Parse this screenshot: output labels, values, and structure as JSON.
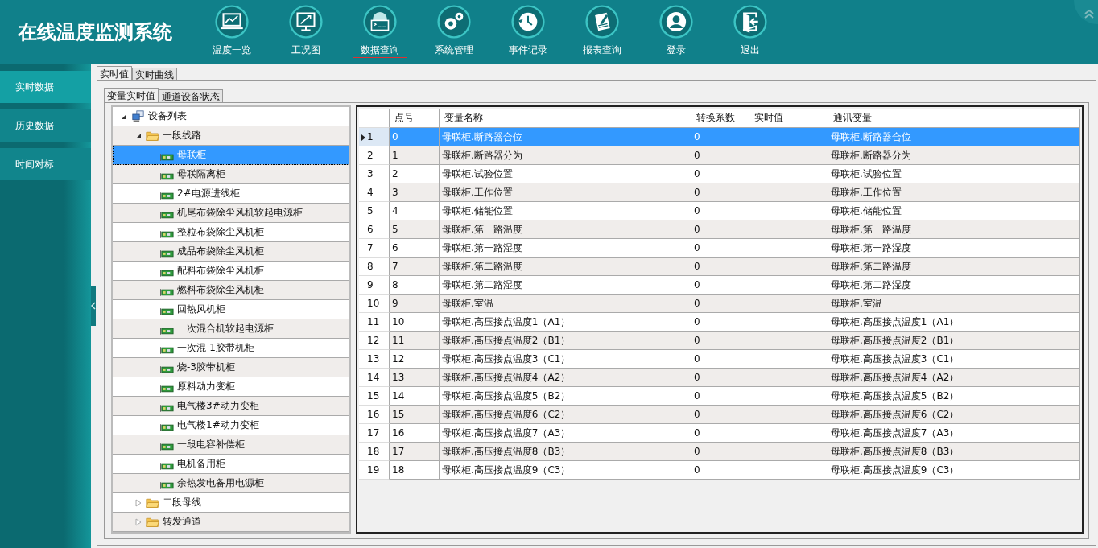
{
  "header": {
    "title": "在线温度监测系统"
  },
  "nav": [
    {
      "label": "温度一览",
      "kind": "monitor-chart",
      "selected": false
    },
    {
      "label": "工况图",
      "kind": "monitor-tools",
      "selected": false
    },
    {
      "label": "数据查询",
      "kind": "gear-terminal",
      "selected": true
    },
    {
      "label": "系统管理",
      "kind": "gears",
      "selected": false
    },
    {
      "label": "事件记录",
      "kind": "clock",
      "selected": false
    },
    {
      "label": "报表查询",
      "kind": "document",
      "selected": false
    },
    {
      "label": "登录",
      "kind": "user",
      "selected": false
    },
    {
      "label": "退出",
      "kind": "exit",
      "selected": false
    }
  ],
  "sidebar": {
    "items": [
      {
        "label": "实时数据",
        "selected": true
      },
      {
        "label": "历史数据",
        "selected": false
      },
      {
        "label": "时间对标",
        "selected": false
      }
    ]
  },
  "tabs": [
    {
      "label": "实时值",
      "selected": true
    },
    {
      "label": "实时曲线",
      "selected": false
    }
  ],
  "sub_tabs": [
    {
      "label": "变量实时值",
      "selected": true
    },
    {
      "label": "通道设备状态",
      "selected": false
    }
  ],
  "tree": [
    {
      "label": "设备列表",
      "kind": "root",
      "expanded": true,
      "selected": false,
      "children": [
        {
          "label": "一段线路",
          "kind": "folder",
          "expanded": true,
          "selected": false,
          "children": [
            {
              "label": "母联柜",
              "kind": "device",
              "selected": true
            },
            {
              "label": "母联隔离柜",
              "kind": "device",
              "selected": false
            },
            {
              "label": "2#电源进线柜",
              "kind": "device",
              "selected": false
            },
            {
              "label": "机尾布袋除尘风机软起电源柜",
              "kind": "device",
              "selected": false
            },
            {
              "label": "整粒布袋除尘风机柜",
              "kind": "device",
              "selected": false
            },
            {
              "label": "成品布袋除尘风机柜",
              "kind": "device",
              "selected": false
            },
            {
              "label": "配料布袋除尘风机柜",
              "kind": "device",
              "selected": false
            },
            {
              "label": "燃料布袋除尘风机柜",
              "kind": "device",
              "selected": false
            },
            {
              "label": "回热风机柜",
              "kind": "device",
              "selected": false
            },
            {
              "label": "一次混合机软起电源柜",
              "kind": "device",
              "selected": false
            },
            {
              "label": "一次混-1胶带机柜",
              "kind": "device",
              "selected": false
            },
            {
              "label": "烧-3胶带机柜",
              "kind": "device",
              "selected": false
            },
            {
              "label": "原料动力变柜",
              "kind": "device",
              "selected": false
            },
            {
              "label": "电气楼3#动力变柜",
              "kind": "device",
              "selected": false
            },
            {
              "label": "电气楼1#动力变柜",
              "kind": "device",
              "selected": false
            },
            {
              "label": "一段电容补偿柜",
              "kind": "device",
              "selected": false
            },
            {
              "label": "电机备用柜",
              "kind": "device",
              "selected": false
            },
            {
              "label": "余热发电备用电源柜",
              "kind": "device",
              "selected": false
            }
          ]
        },
        {
          "label": "二段母线",
          "kind": "folder",
          "expanded": false,
          "selected": false
        },
        {
          "label": "转发通道",
          "kind": "folder",
          "expanded": false,
          "selected": false
        }
      ]
    }
  ],
  "table": {
    "columns": [
      "点号",
      "变量名称",
      "转换系数",
      "实时值",
      "通讯变量"
    ],
    "rows": [
      {
        "row": "1",
        "selected": true,
        "cells": [
          "0",
          "母联柜.断路器合位",
          "0",
          "",
          "母联柜.断路器合位"
        ]
      },
      {
        "row": "2",
        "selected": false,
        "cells": [
          "1",
          "母联柜.断路器分为",
          "0",
          "",
          "母联柜.断路器分为"
        ]
      },
      {
        "row": "3",
        "selected": false,
        "cells": [
          "2",
          "母联柜.试验位置",
          "0",
          "",
          "母联柜.试验位置"
        ]
      },
      {
        "row": "4",
        "selected": false,
        "cells": [
          "3",
          "母联柜.工作位置",
          "0",
          "",
          "母联柜.工作位置"
        ]
      },
      {
        "row": "5",
        "selected": false,
        "cells": [
          "4",
          "母联柜.储能位置",
          "0",
          "",
          "母联柜.储能位置"
        ]
      },
      {
        "row": "6",
        "selected": false,
        "cells": [
          "5",
          "母联柜.第一路温度",
          "0",
          "",
          "母联柜.第一路温度"
        ]
      },
      {
        "row": "7",
        "selected": false,
        "cells": [
          "6",
          "母联柜.第一路湿度",
          "0",
          "",
          "母联柜.第一路湿度"
        ]
      },
      {
        "row": "8",
        "selected": false,
        "cells": [
          "7",
          "母联柜.第二路温度",
          "0",
          "",
          "母联柜.第二路温度"
        ]
      },
      {
        "row": "9",
        "selected": false,
        "cells": [
          "8",
          "母联柜.第二路湿度",
          "0",
          "",
          "母联柜.第二路湿度"
        ]
      },
      {
        "row": "10",
        "selected": false,
        "cells": [
          "9",
          "母联柜.室温",
          "0",
          "",
          "母联柜.室温"
        ]
      },
      {
        "row": "11",
        "selected": false,
        "cells": [
          "10",
          "母联柜.高压接点温度1（A1）",
          "0",
          "",
          "母联柜.高压接点温度1（A1）"
        ]
      },
      {
        "row": "12",
        "selected": false,
        "cells": [
          "11",
          "母联柜.高压接点温度2（B1）",
          "0",
          "",
          "母联柜.高压接点温度2（B1）"
        ]
      },
      {
        "row": "13",
        "selected": false,
        "cells": [
          "12",
          "母联柜.高压接点温度3（C1）",
          "0",
          "",
          "母联柜.高压接点温度3（C1）"
        ]
      },
      {
        "row": "14",
        "selected": false,
        "cells": [
          "13",
          "母联柜.高压接点温度4（A2）",
          "0",
          "",
          "母联柜.高压接点温度4（A2）"
        ]
      },
      {
        "row": "15",
        "selected": false,
        "cells": [
          "14",
          "母联柜.高压接点温度5（B2）",
          "0",
          "",
          "母联柜.高压接点温度5（B2）"
        ]
      },
      {
        "row": "16",
        "selected": false,
        "cells": [
          "15",
          "母联柜.高压接点温度6（C2）",
          "0",
          "",
          "母联柜.高压接点温度6（C2）"
        ]
      },
      {
        "row": "17",
        "selected": false,
        "cells": [
          "16",
          "母联柜.高压接点温度7（A3）",
          "0",
          "",
          "母联柜.高压接点温度7（A3）"
        ]
      },
      {
        "row": "18",
        "selected": false,
        "cells": [
          "17",
          "母联柜.高压接点温度8（B3）",
          "0",
          "",
          "母联柜.高压接点温度8（B3）"
        ]
      },
      {
        "row": "19",
        "selected": false,
        "cells": [
          "18",
          "母联柜.高压接点温度9（C3）",
          "0",
          "",
          "母联柜.高压接点温度9（C3）"
        ]
      }
    ]
  }
}
